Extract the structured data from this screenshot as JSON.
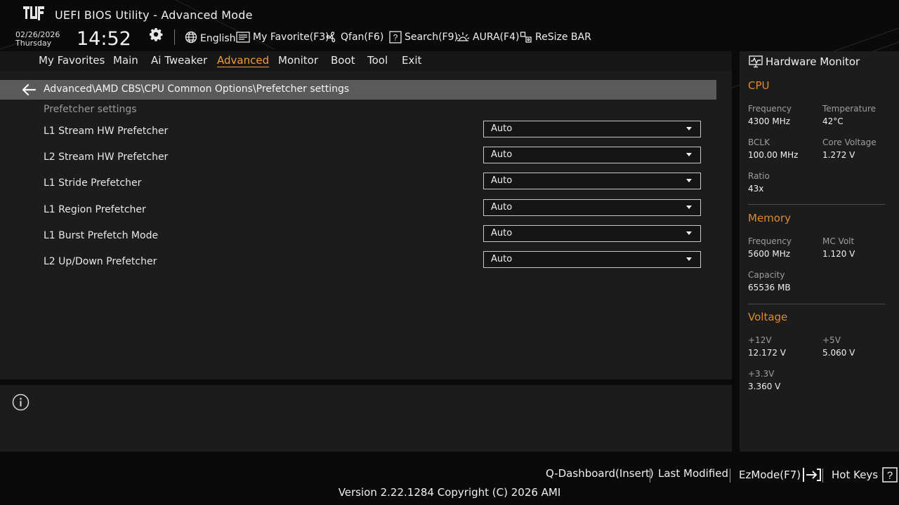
{
  "header": {
    "app_title": "UEFI BIOS Utility - Advanced Mode",
    "date": "02/26/2026",
    "weekday": "Thursday",
    "time": "14:52",
    "toolbar": {
      "language": "English",
      "my_favorite": "My Favorite(F3)",
      "qfan": "Qfan(F6)",
      "search": "Search(F9)",
      "aura": "AURA(F4)",
      "resize_bar": "ReSize BAR"
    }
  },
  "nav": {
    "tabs": [
      {
        "label": "My Favorites"
      },
      {
        "label": "Main"
      },
      {
        "label": "Ai Tweaker"
      },
      {
        "label": "Advanced"
      },
      {
        "label": "Monitor"
      },
      {
        "label": "Boot"
      },
      {
        "label": "Tool"
      },
      {
        "label": "Exit"
      }
    ],
    "active": "Advanced"
  },
  "main": {
    "breadcrumb": "Advanced\\AMD CBS\\CPU Common Options\\Prefetcher settings",
    "section_title": "Prefetcher settings",
    "settings": [
      {
        "label": "L1 Stream HW Prefetcher",
        "value": "Auto"
      },
      {
        "label": "L2 Stream HW Prefetcher",
        "value": "Auto"
      },
      {
        "label": "L1 Stride Prefetcher",
        "value": "Auto"
      },
      {
        "label": "L1 Region Prefetcher",
        "value": "Auto"
      },
      {
        "label": "L1 Burst Prefetch Mode",
        "value": "Auto"
      },
      {
        "label": "L2 Up/Down Prefetcher",
        "value": "Auto"
      }
    ]
  },
  "hardware_monitor": {
    "title": "Hardware Monitor",
    "cpu": {
      "section": "CPU",
      "frequency_label": "Frequency",
      "frequency": "4300 MHz",
      "temperature_label": "Temperature",
      "temperature": "42°C",
      "bclk_label": "BCLK",
      "bclk": "100.00 MHz",
      "core_voltage_label": "Core Voltage",
      "core_voltage": "1.272 V",
      "ratio_label": "Ratio",
      "ratio": "43x"
    },
    "memory": {
      "section": "Memory",
      "frequency_label": "Frequency",
      "frequency": "5600 MHz",
      "mc_volt_label": "MC Volt",
      "mc_volt": "1.120 V",
      "capacity_label": "Capacity",
      "capacity": "65536 MB"
    },
    "voltage": {
      "section": "Voltage",
      "v12_label": "+12V",
      "v12": "12.172 V",
      "v5_label": "+5V",
      "v5": "5.060 V",
      "v33_label": "+3.3V",
      "v33": "3.360 V"
    }
  },
  "footer": {
    "q_dashboard": "Q-Dashboard(Insert)",
    "last_modified": "Last Modified",
    "ezmode": "EzMode(F7)",
    "hot_keys": "Hot Keys",
    "version": "Version 2.22.1284 Copyright (C) 2026 AMI"
  },
  "colors": {
    "accent": "#e08a2a",
    "active_tab": "#f0a030",
    "breadcrumb_bar": "#5a5a5a",
    "panel": "#1c1c1c"
  }
}
